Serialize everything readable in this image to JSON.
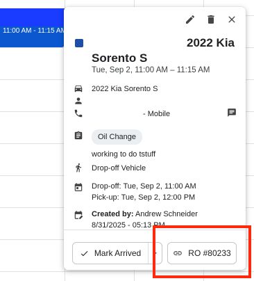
{
  "calendar_event": {
    "time_label": "11:00 AM - 11:15 AM"
  },
  "popup": {
    "title_right": "2022 Kia",
    "title_main": "Sorento S",
    "subtitle": "Tue, Sep 2, 11:00 AM – 11:15 AM",
    "vehicle": "2022 Kia Sorento S",
    "phone_suffix": "- Mobile",
    "service_chip": "Oil Change",
    "notes": "working to do tstuff",
    "transport": "Drop-off Vehicle",
    "dropoff": "Drop-off: Tue, Sep 2, 11:00 AM",
    "pickup": "Pick-up: Tue, Sep 2, 12:00 PM",
    "created_label": "Created by:",
    "created_by": "Andrew Schneider",
    "created_at": "8/31/2025 - 05:13 PM"
  },
  "footer": {
    "mark_arrived_label": "Mark Arrived",
    "ro_label": "RO #80233"
  },
  "icons": {
    "edit": "pencil-icon",
    "delete": "trash-icon",
    "close": "close-icon",
    "car": "car-icon",
    "person": "person-icon",
    "phone": "phone-icon",
    "chat": "chat-icon",
    "clipboard": "clipboard-icon",
    "transport": "person-walking-icon",
    "calendar": "calendar-icon",
    "created": "edit-calendar-icon",
    "check": "check-icon",
    "caret": "chevron-down-icon",
    "link": "link-icon"
  },
  "colors": {
    "event_block": "#0b57d0",
    "title_square": "#1f4ea6",
    "highlight": "#ff2a0d"
  }
}
